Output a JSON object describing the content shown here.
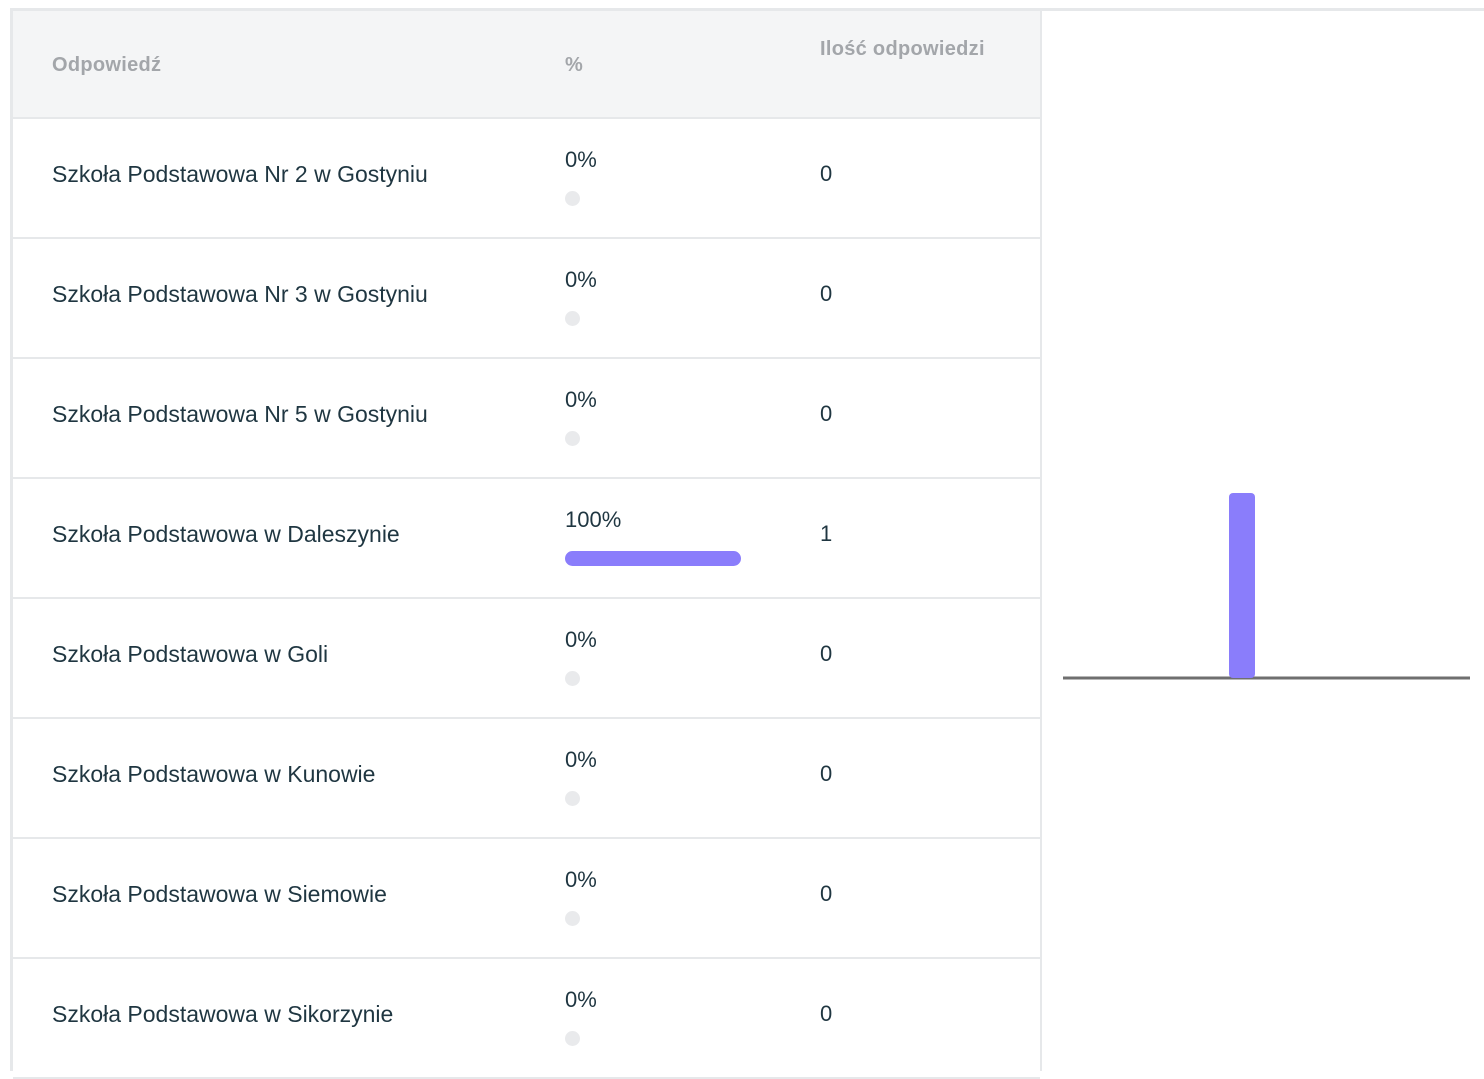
{
  "table": {
    "headers": {
      "answer": "Odpowiedź",
      "percent": "%",
      "count": "Ilość odpowiedzi"
    },
    "rows": [
      {
        "answer": "Szkoła Podstawowa Nr 2 w Gostyniu",
        "percent_label": "0%",
        "percent": 0,
        "count": "0"
      },
      {
        "answer": "Szkoła Podstawowa Nr 3 w Gostyniu",
        "percent_label": "0%",
        "percent": 0,
        "count": "0"
      },
      {
        "answer": "Szkoła Podstawowa Nr 5 w Gostyniu",
        "percent_label": "0%",
        "percent": 0,
        "count": "0"
      },
      {
        "answer": "Szkoła Podstawowa w Daleszynie",
        "percent_label": "100%",
        "percent": 100,
        "count": "1"
      },
      {
        "answer": "Szkoła Podstawowa w Goli",
        "percent_label": "0%",
        "percent": 0,
        "count": "0"
      },
      {
        "answer": "Szkoła Podstawowa w Kunowie",
        "percent_label": "0%",
        "percent": 0,
        "count": "0"
      },
      {
        "answer": "Szkoła Podstawowa w Siemowie",
        "percent_label": "0%",
        "percent": 0,
        "count": "0"
      },
      {
        "answer": "Szkoła Podstawowa w Sikorzynie",
        "percent_label": "0%",
        "percent": 0,
        "count": "0"
      }
    ]
  },
  "colors": {
    "accent": "#8a7dfb",
    "text": "#1f3641",
    "header_text": "#a3a6aa",
    "track": "#e9eaec",
    "border": "#e6e8ea",
    "axis": "#6f6f6f"
  },
  "chart_data": {
    "type": "bar",
    "categories": [
      "Szkoła Podstawowa Nr 2 w Gostyniu",
      "Szkoła Podstawowa Nr 3 w Gostyniu",
      "Szkoła Podstawowa Nr 5 w Gostyniu",
      "Szkoła Podstawowa w Daleszynie",
      "Szkoła Podstawowa w Goli",
      "Szkoła Podstawowa w Kunowie",
      "Szkoła Podstawowa w Siemowie",
      "Szkoła Podstawowa w Sikorzynie"
    ],
    "values": [
      0,
      0,
      0,
      1,
      0,
      0,
      0,
      0
    ],
    "ylim": [
      0,
      1
    ],
    "grid": false,
    "color": "#8a7dfb"
  }
}
